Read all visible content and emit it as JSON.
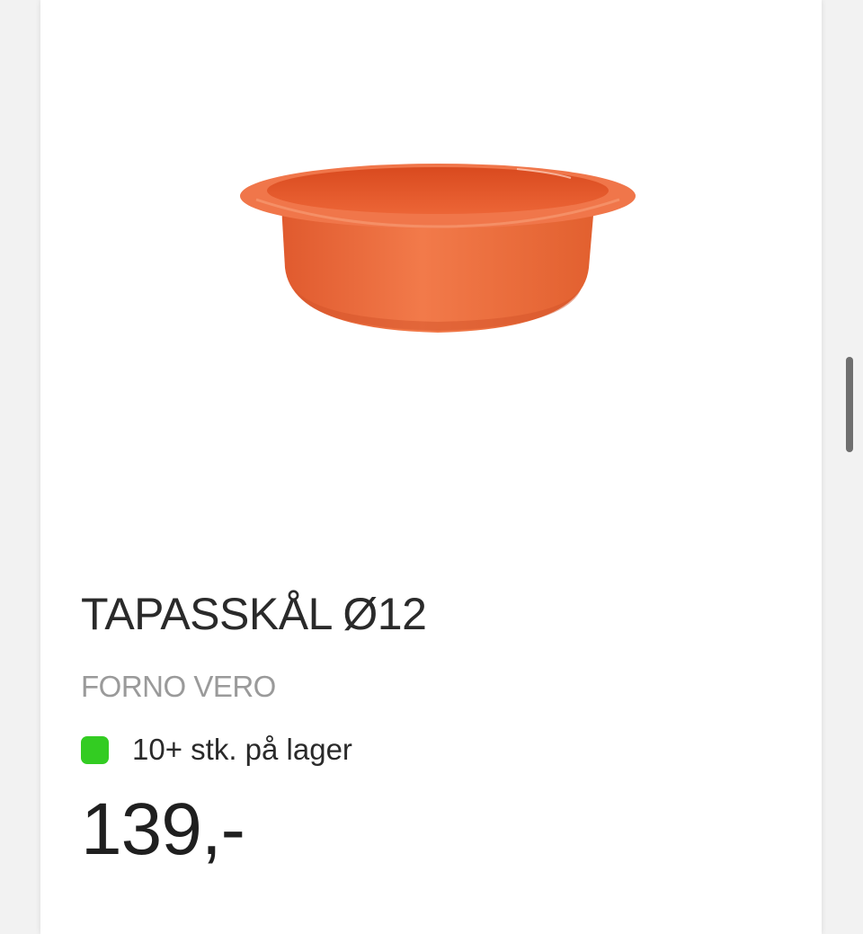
{
  "product": {
    "image_icon": "terracotta-bowl-image",
    "title": "TAPASSKÅL Ø12",
    "brand": "FORNO VERO",
    "stock_text": "10+ stk. på lager",
    "stock_status_color": "#33cc22",
    "price": "139,-"
  },
  "colors": {
    "bowl_main": "#ee6a3c",
    "bowl_shadow": "#d9542a",
    "bowl_inner": "#e8582a",
    "text_primary": "#2a2a2a",
    "text_muted": "#9a9a9a"
  }
}
